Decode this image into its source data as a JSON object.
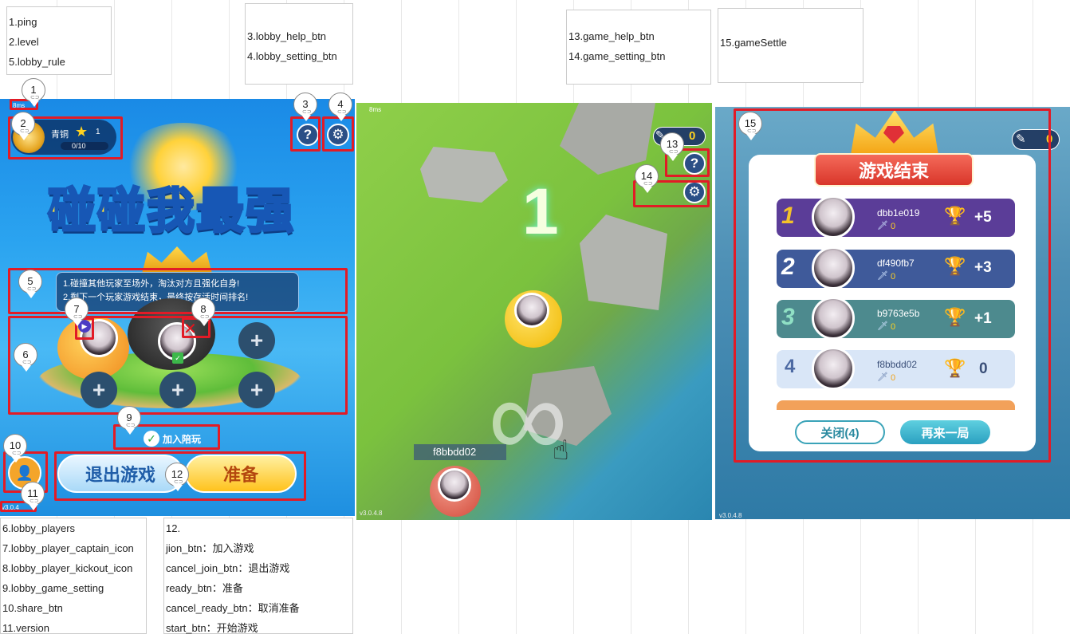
{
  "notes": {
    "top_left": [
      "1.ping",
      "2.level",
      "5.lobby_rule"
    ],
    "top_mid": [
      "3.lobby_help_btn",
      "4.lobby_setting_btn"
    ],
    "top_game": [
      "13.game_help_btn",
      "14.game_setting_btn"
    ],
    "top_settle": [
      "15.gameSettle"
    ],
    "bottom_left": [
      "6.lobby_players",
      "7.lobby_player_captain_icon",
      "8.lobby_player_kickout_icon",
      "9.lobby_game_setting",
      "10.share_btn",
      "11.version"
    ],
    "bottom_right": [
      "12.",
      "jion_btn：加入游戏",
      "cancel_join_btn：退出游戏",
      "ready_btn：准备",
      "cancel_ready_btn：取消准备",
      "start_btn：开始游戏"
    ]
  },
  "pins": [
    "1",
    "2",
    "3",
    "4",
    "5",
    "6",
    "7",
    "8",
    "9",
    "10",
    "11",
    "12",
    "13",
    "14",
    "15"
  ],
  "lobby": {
    "ping": "8ms",
    "level_name": "青铜",
    "stars": "1",
    "progress": "0/10",
    "progress_fraction": 0,
    "title": "碰碰我最强",
    "rule_line1": "1.碰撞其他玩家至场外，淘汰对方且强化自身!",
    "rule_line2": "2.剩下一个玩家游戏结束，最终按存活时间排名!",
    "help_icon": "?",
    "plus": "+",
    "join_label": "加入陪玩",
    "quit_button": "退出游戏",
    "ready_button": "准备",
    "version": "v3.0.4"
  },
  "game": {
    "ping": "8ms",
    "countdown": "1",
    "score": "0",
    "player_name": "f8bbdd02",
    "help_icon": "?",
    "version": "v3.0.4.8"
  },
  "settle": {
    "title": "游戏结束",
    "score": "0",
    "rows": [
      {
        "rank": "1",
        "name": "dbb1e019",
        "kills": "0",
        "delta": "+5",
        "bg": "#5b3d98"
      },
      {
        "rank": "2",
        "name": "df490fb7",
        "kills": "0",
        "delta": "+3",
        "bg": "#3f5a9a"
      },
      {
        "rank": "3",
        "name": "b9763e5b",
        "kills": "0",
        "delta": "+1",
        "bg": "#4d8a8e"
      },
      {
        "rank": "4",
        "name": "f8bbdd02",
        "kills": "0",
        "delta": "0",
        "bg": "#d9e6f7"
      }
    ],
    "close_button": "关闭(4)",
    "again_button": "再来一局",
    "version": "v3.0.4.8"
  },
  "colors": {
    "annotation_red": "#e21b26",
    "lobby_sky": "#1e8fe0",
    "ready_yellow": "#ffc21c",
    "settle_header": "#e8483a"
  }
}
